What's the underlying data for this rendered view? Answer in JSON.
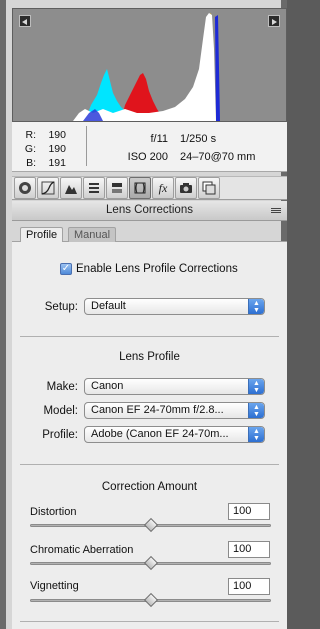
{
  "histogram": {
    "clip_left_icon": "shadow-clipping-warning-icon",
    "clip_right_icon": "highlight-clipping-warning-icon",
    "colors": {
      "cyan": "#00e5ff",
      "red": "#e0141c",
      "blue": "#1e2bd6",
      "yellow": "#f0d000",
      "white": "#ffffff"
    }
  },
  "info": {
    "r_label": "R:",
    "r_value": "190",
    "g_label": "G:",
    "g_value": "190",
    "b_label": "B:",
    "b_value": "191",
    "aperture": "f/11",
    "shutter": "1/250 s",
    "iso": "ISO 200",
    "lens": "24–70@70 mm"
  },
  "toolbar": {
    "tools": [
      "basic-icon",
      "tone-curve-icon",
      "detail-icon",
      "hsl-icon",
      "split-toning-icon",
      "lens-corrections-icon",
      "effects-icon",
      "camera-calibration-icon",
      "presets-icon"
    ],
    "active_index": 5
  },
  "panel": {
    "title": "Lens Corrections",
    "menu_icon": "panel-menu-icon"
  },
  "subtabs": {
    "profile": "Profile",
    "manual": "Manual"
  },
  "content": {
    "enable_label": "Enable Lens Profile Corrections",
    "enable_checked": true,
    "setup_label": "Setup:",
    "setup_value": "Default",
    "lens_profile_title": "Lens Profile",
    "make_label": "Make:",
    "make_value": "Canon",
    "model_label": "Model:",
    "model_value": "Canon EF 24-70mm f/2.8...",
    "profile_label": "Profile:",
    "profile_value": "Adobe (Canon EF 24-70m...",
    "correction_title": "Correction Amount",
    "distortion_label": "Distortion",
    "distortion_value": "100",
    "chromatic_label": "Chromatic Aberration",
    "chromatic_value": "100",
    "vignetting_label": "Vignetting",
    "vignetting_value": "100",
    "slider_level_fraction": 0.5
  }
}
